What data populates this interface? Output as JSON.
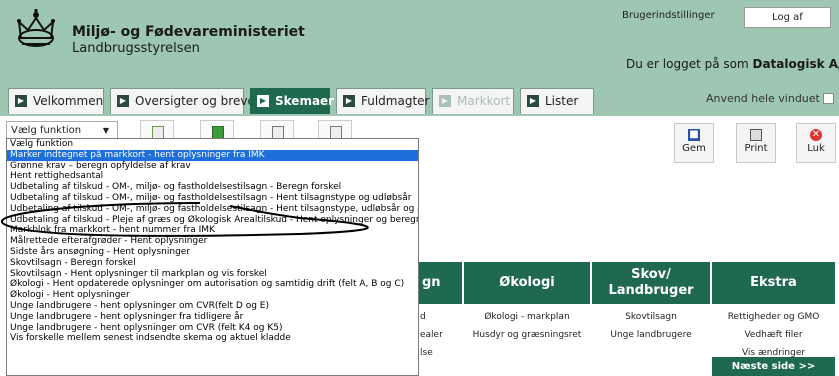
{
  "header": {
    "ministry": "Miljø- og Fødevareministeriet",
    "agency": "Landbrugsstyrelsen",
    "user_settings": "Brugerindstillinger",
    "logout": "Log af",
    "logged_in_prefix": "Du er logget på som",
    "logged_in_user": "Datalogisk A/S"
  },
  "tabs": [
    {
      "label": "Velkommen"
    },
    {
      "label": "Oversigter og breve"
    },
    {
      "label": "Skemaer"
    },
    {
      "label": "Fuldmagter"
    },
    {
      "label": "Markkort"
    },
    {
      "label": "Lister"
    }
  ],
  "full_window": "Anvend hele vinduet",
  "toolbar": {
    "select_value": "Vælg funktion",
    "save": "Gem",
    "print": "Print",
    "close": "Luk"
  },
  "dropdown": {
    "options": [
      "Vælg funktion",
      "Marker indtegnet på markkort - hent oplysninger fra IMK",
      "Grønne krav – beregn opfyldelse af krav",
      "Hent rettighedsantal",
      "Udbetaling af tilskud - OM-, miljø- og fastholdelsestilsagn - Beregn forskel",
      "Udbetaling af tilskud - OM-, miljø- og fastholdelsestilsagn - Hent tilsagnstype og udløbsår",
      "Udbetaling af tilskud - OM-, miljø- og fastholdelsestilsagn - Hent tilsagnstype, udløbsår og areal",
      "Udbetaling af tilskud - Pleje af græs og Økologisk Arealtilskud - Hent oplysninger og beregn forskel",
      "Markblok fra markkort - hent nummer fra IMK",
      "Målrettede efterafgrøder - Hent oplysninger",
      "Sidste års ansøgning - Hent oplysninger",
      "Skovtilsagn - Beregn forskel",
      "Skovtilsagn - Hent oplysninger til markplan og vis forskel",
      "Økologi - Hent opdaterede oplysninger om autorisation og samtidig drift (felt A, B og C)",
      "Økologi - Hent oplysninger",
      "Unge landbrugere - hent oplysninger om CVR(felt D og E)",
      "Unge landbrugere - hent oplysninger fra tidligere år",
      "Unge landbrugere - hent oplysninger om CVR (felt K4 og K5)",
      "Vis forskelle mellem senest indsendte skema og aktuel kladde"
    ]
  },
  "table": {
    "headers": [
      {
        "lines": [
          "gn"
        ]
      },
      {
        "lines": [
          "Økologi"
        ]
      },
      {
        "lines": [
          "Skov/",
          "Landbruger"
        ]
      },
      {
        "lines": [
          "Ekstra"
        ]
      }
    ],
    "fragments": [
      "d",
      "ealer",
      "lse"
    ],
    "okologi": [
      "Økologi - markplan",
      "Husdyr og græsningsret"
    ],
    "skov": [
      "Skovtilsagn",
      "Unge landbrugere"
    ],
    "ekstra": [
      "Rettigheder og GMO",
      "Vedhæft filer",
      "Vis ændringer"
    ],
    "next_page": "Næste side >>"
  },
  "colors": {
    "banner": "#9dc7b2",
    "accent": "#1f6a4f",
    "selection": "#1e6fd9",
    "annotation": "#000000"
  }
}
